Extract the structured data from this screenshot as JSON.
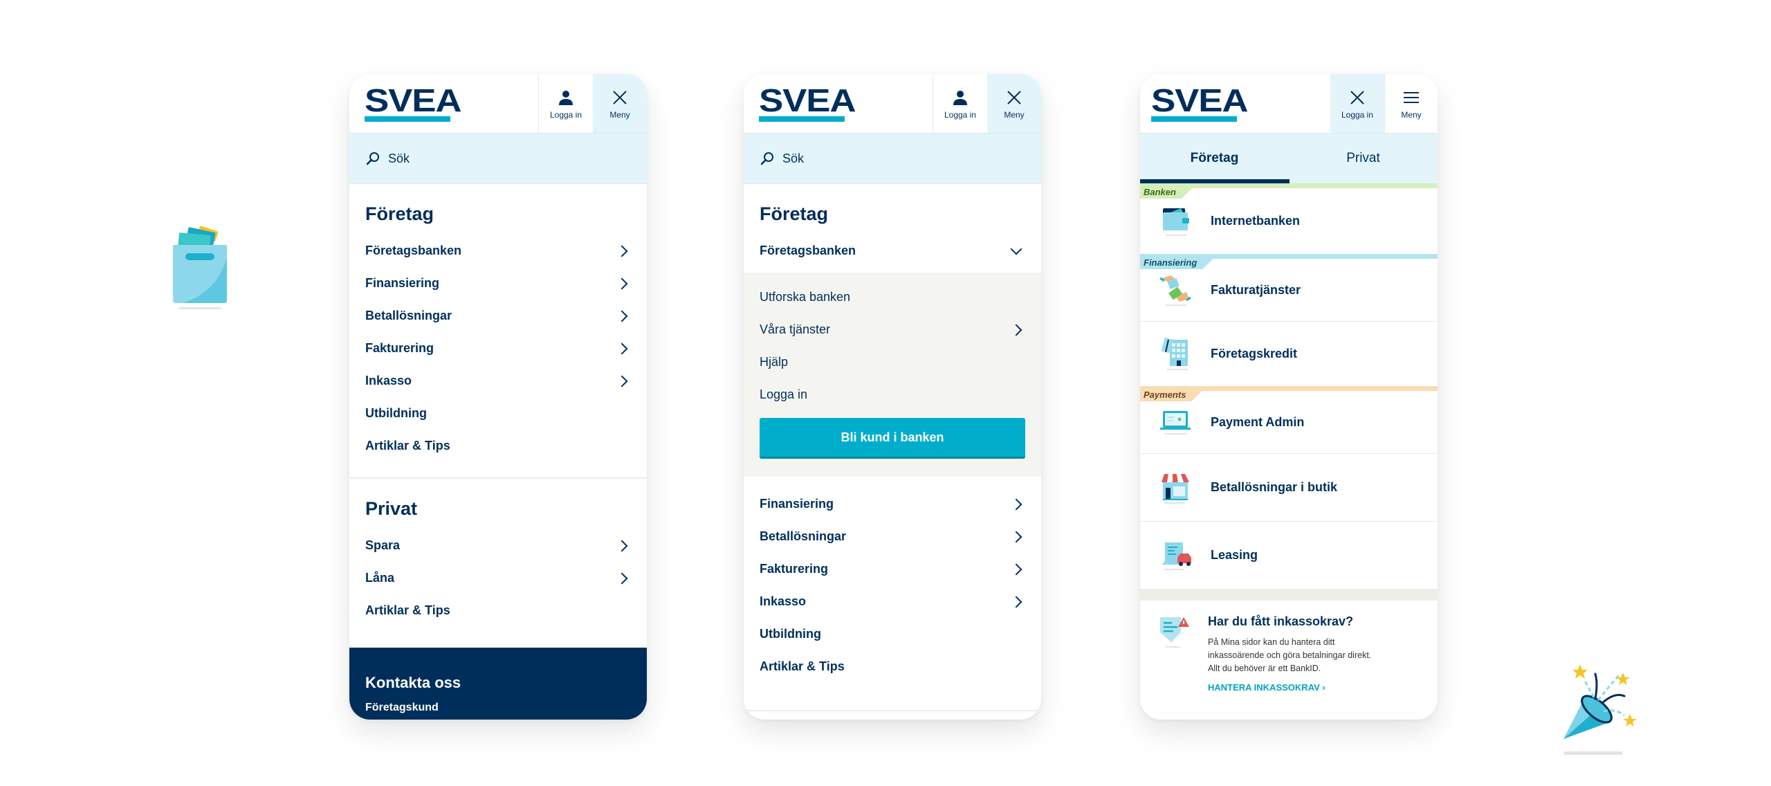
{
  "brand": {
    "logo_text": "SVEA",
    "primary_color": "#002e5b",
    "accent_color": "#00aecb",
    "tint_color": "#e3f5fb"
  },
  "screens": [
    {
      "header": {
        "login_label": "Logga in",
        "menu_label": "Meny",
        "menu_state": "open"
      },
      "search": {
        "placeholder": "Sök"
      },
      "sections": [
        {
          "title": "Företag",
          "items": [
            {
              "label": "Företagsbanken",
              "has_chevron": true
            },
            {
              "label": "Finansiering",
              "has_chevron": true
            },
            {
              "label": "Betallösningar",
              "has_chevron": true
            },
            {
              "label": "Fakturering",
              "has_chevron": true
            },
            {
              "label": "Inkasso",
              "has_chevron": true
            },
            {
              "label": "Utbildning",
              "has_chevron": false
            },
            {
              "label": "Artiklar & Tips",
              "has_chevron": false
            }
          ]
        },
        {
          "title": "Privat",
          "items": [
            {
              "label": "Spara",
              "has_chevron": true
            },
            {
              "label": "Låna",
              "has_chevron": true
            },
            {
              "label": "Artiklar & Tips",
              "has_chevron": false
            }
          ]
        }
      ],
      "contact": {
        "title": "Kontakta oss",
        "subtitle": "Företagskund"
      }
    },
    {
      "header": {
        "login_label": "Logga in",
        "menu_label": "Meny",
        "menu_state": "open"
      },
      "search": {
        "placeholder": "Sök"
      },
      "section_title": "Företag",
      "expanded_item": {
        "label": "Företagsbanken",
        "expanded": true
      },
      "sub_items": [
        {
          "label": "Utforska banken",
          "has_chevron": false
        },
        {
          "label": "Våra tjänster",
          "has_chevron": true
        },
        {
          "label": "Hjälp",
          "has_chevron": false
        },
        {
          "label": "Logga in",
          "has_chevron": false
        }
      ],
      "cta_label": "Bli kund i banken",
      "items": [
        {
          "label": "Finansiering",
          "has_chevron": true
        },
        {
          "label": "Betallösningar",
          "has_chevron": true
        },
        {
          "label": "Fakturering",
          "has_chevron": true
        },
        {
          "label": "Inkasso",
          "has_chevron": true
        },
        {
          "label": "Utbildning",
          "has_chevron": false
        },
        {
          "label": "Artiklar & Tips",
          "has_chevron": false
        }
      ]
    },
    {
      "header": {
        "login_label": "Logga in",
        "menu_label": "Meny",
        "login_state": "open"
      },
      "tabs": [
        {
          "label": "Företag",
          "selected": true
        },
        {
          "label": "Privat",
          "selected": false
        }
      ],
      "groups": [
        {
          "name": "Banken",
          "color": "#d4eebc",
          "text_color": "#3d6b12",
          "items": [
            {
              "label": "Internetbanken",
              "icon": "wallet-icon"
            }
          ]
        },
        {
          "name": "Finansiering",
          "color": "#b2e4ef",
          "text_color": "#0d5566",
          "items": [
            {
              "label": "Fakturatjänster",
              "icon": "invoice-exchange-icon"
            },
            {
              "label": "Företagskredit",
              "icon": "office-building-icon"
            }
          ]
        },
        {
          "name": "Payments",
          "color": "#f8dcb4",
          "text_color": "#6b4410",
          "items": [
            {
              "label": "Payment Admin",
              "icon": "laptop-icon"
            },
            {
              "label": "Betallösningar i butik",
              "icon": "storefront-icon"
            },
            {
              "label": "Leasing",
              "icon": "leasing-car-icon"
            }
          ]
        }
      ],
      "info_card": {
        "title": "Har du fått inkassokrav?",
        "body": "På Mina sidor kan du hantera ditt inkassoärende och göra betalningar direkt. Allt du behöver är ett BankID.",
        "link_label": "HANTERA INKASSOKRAV"
      }
    }
  ],
  "decorations": [
    "file-box-icon",
    "party-popper-icon"
  ]
}
